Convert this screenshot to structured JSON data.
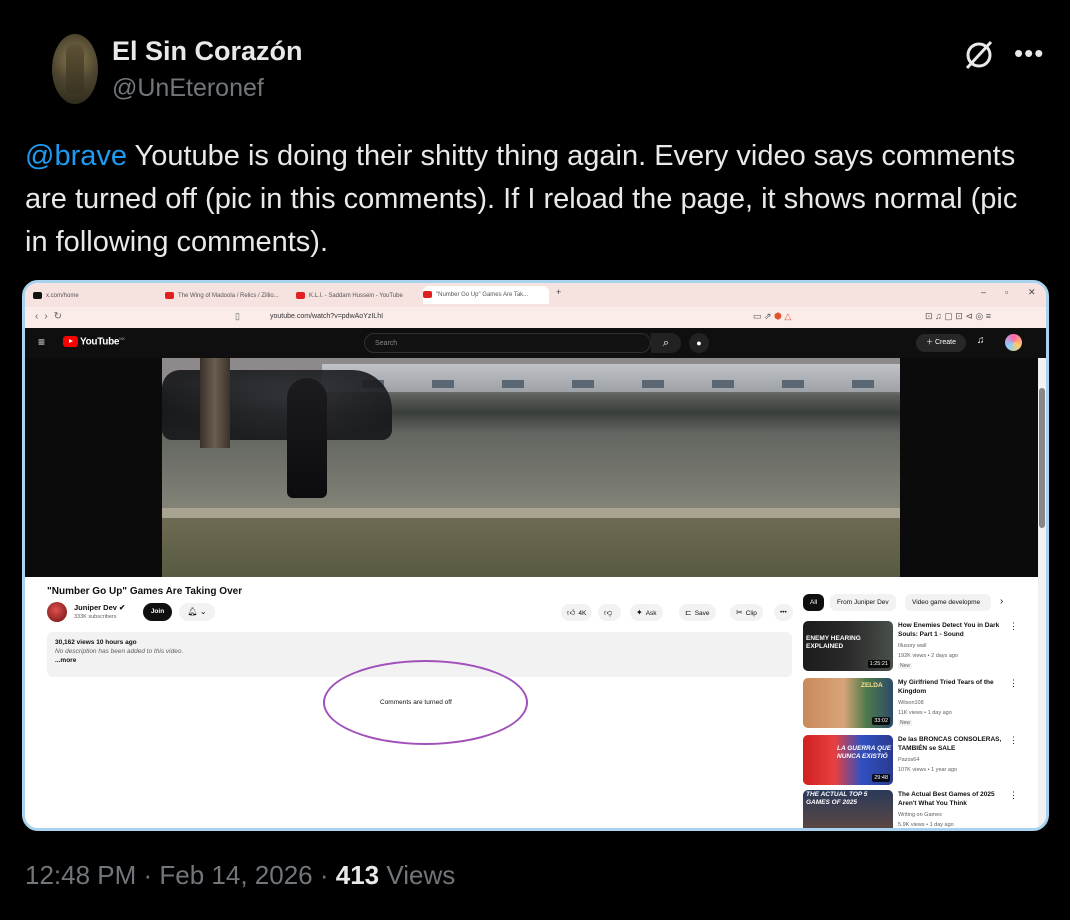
{
  "author": {
    "name": "El Sin Corazón",
    "handle": "@UnEteronef"
  },
  "tweet": {
    "mention": "@brave",
    "text": " Youtube is doing their shitty thing again. Every video says comments are turned off (pic in this comments). If I reload the page, it shows normal (pic in following comments)."
  },
  "footer": {
    "time": "12:48 PM",
    "sep1": " · ",
    "date": "Feb 14, 2026",
    "sep2": " · ",
    "views_count": "413",
    "views_label": " Views"
  },
  "colors": {
    "link": "#1d9bf0",
    "annotation_circle": "#a050b8",
    "youtube_red": "#ff0000"
  },
  "screenshot": {
    "tabs": [
      {
        "label": "x.com/home",
        "icon": "x-icon"
      },
      {
        "label": "The Wing of Madoola / Relics / Zillio...",
        "icon": "youtube-icon"
      },
      {
        "label": "K.L.I. - Saddam Hussein - YouTube",
        "icon": "youtube-icon"
      },
      {
        "label": "\"Number Go Up\" Games Are Tak...",
        "icon": "youtube-icon"
      }
    ],
    "new_tab": "+",
    "url": "youtube.com/watch?v=pdwAoYzILhI",
    "youtube": {
      "logo": "YouTube",
      "region": "MX",
      "search_placeholder": "Search",
      "create_label": "Create"
    },
    "video": {
      "title": "\"Number Go Up\" Games Are Taking Over",
      "channel": "Juniper Dev",
      "subscribers": "333K subscribers",
      "join_label": "Join",
      "like_count": "4K",
      "ask_label": "Ask",
      "save_label": "Save",
      "clip_label": "Clip",
      "views_time": "30,162 views  10 hours ago",
      "description": "No description has been added to this video.",
      "more_label": "...more",
      "comments_status": "Comments are turned off"
    },
    "chips": [
      "All",
      "From Juniper Dev",
      "Video game developme"
    ],
    "recommendations": [
      {
        "title": "How Enemies Detect You in Dark Souls: Part 1 - Sound",
        "channel": "Illusory wall",
        "meta": "192K views • 2 days ago",
        "badge": "New",
        "duration": "1:25:21",
        "thumb_text": "ENEMY HEARING EXPLAINED"
      },
      {
        "title": "My Girlfriend Tried Tears of the Kingdom",
        "channel": "Wilson108",
        "meta": "11K views • 1 day ago",
        "badge": "New",
        "duration": "33:02",
        "thumb_text": "ZELDA"
      },
      {
        "title": "De las BRONCAS CONSOLERAS, TAMBIÉN se SALE",
        "channel": "Pazos64",
        "meta": "107K views • 1 year ago",
        "badge": "",
        "duration": "29:48",
        "thumb_text": "LA GUERRA QUE NUNCA EXISTIÓ"
      },
      {
        "title": "The Actual Best Games of 2025 Aren't What You Think",
        "channel": "Writing on Games",
        "meta": "5.9K views • 1 day ago",
        "badge": "",
        "duration": "",
        "thumb_text": "THE ACTUAL TOP 5 GAMES OF 2025"
      }
    ]
  }
}
